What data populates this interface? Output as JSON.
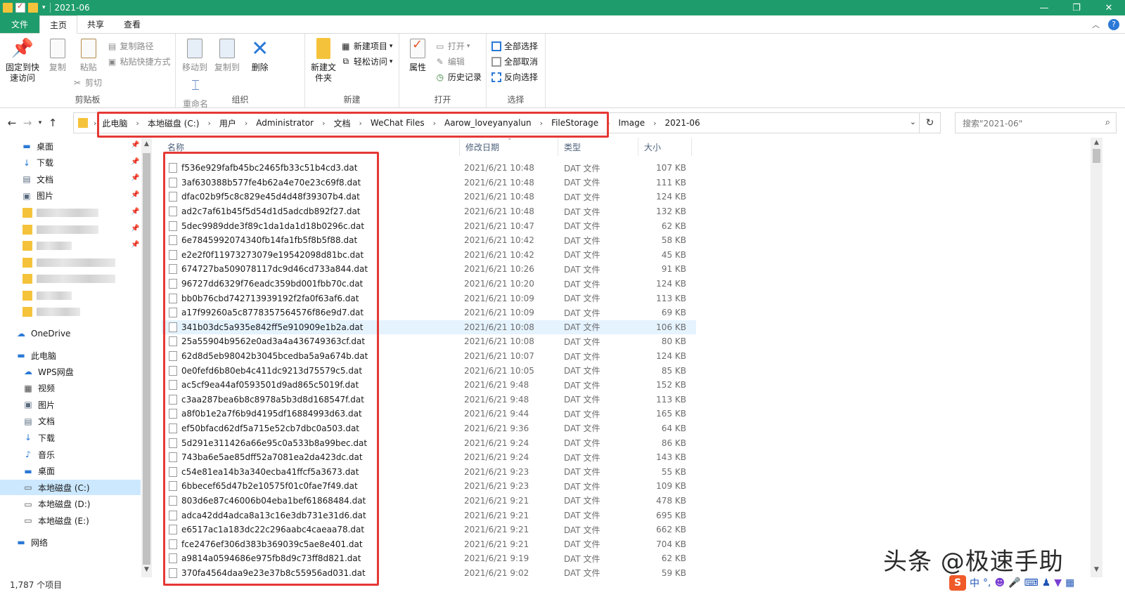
{
  "window": {
    "title": "2021-06",
    "minimize": "—",
    "restore": "❐",
    "close": "✕"
  },
  "tabs": [
    "文件",
    "主页",
    "共享",
    "查看"
  ],
  "ribbon": {
    "clipboard": {
      "group": "剪贴板",
      "pin": "固定到快速访问",
      "copy": "复制",
      "paste": "粘贴",
      "copy_path": "复制路径",
      "paste_shortcut": "粘贴快捷方式",
      "cut": "剪切"
    },
    "organize": {
      "group": "组织",
      "move_to": "移动到",
      "copy_to": "复制到",
      "delete": "删除",
      "rename": "重命名"
    },
    "new": {
      "group": "新建",
      "new_folder": "新建文件夹",
      "new_item": "新建项目",
      "easy_access": "轻松访问"
    },
    "open": {
      "group": "打开",
      "properties": "属性",
      "open": "打开",
      "edit": "编辑",
      "history": "历史记录"
    },
    "select": {
      "group": "选择",
      "select_all": "全部选择",
      "select_none": "全部取消",
      "invert": "反向选择"
    }
  },
  "address": {
    "crumbs": [
      "此电脑",
      "本地磁盘 (C:)",
      "用户",
      "Administrator",
      "文档",
      "WeChat Files",
      "Aarow_loveyanyalun",
      "FileStorage",
      "Image",
      "2021-06"
    ],
    "search_placeholder": "搜索\"2021-06\""
  },
  "nav": {
    "quick": [
      {
        "label": "桌面",
        "icon": "desktop-icon"
      },
      {
        "label": "下载",
        "icon": "download-icon"
      },
      {
        "label": "文档",
        "icon": "document-icon"
      },
      {
        "label": "图片",
        "icon": "picture-icon"
      }
    ],
    "onedrive": "OneDrive",
    "thispc": "此电脑",
    "pc_items": [
      {
        "label": "WPS网盘",
        "icon": "cloud-icon"
      },
      {
        "label": "视频",
        "icon": "video-icon"
      },
      {
        "label": "图片",
        "icon": "picture-icon"
      },
      {
        "label": "文档",
        "icon": "document-icon"
      },
      {
        "label": "下载",
        "icon": "download-icon"
      },
      {
        "label": "音乐",
        "icon": "music-icon"
      },
      {
        "label": "桌面",
        "icon": "desktop-icon"
      },
      {
        "label": "本地磁盘 (C:)",
        "icon": "drive-icon",
        "selected": true
      },
      {
        "label": "本地磁盘 (D:)",
        "icon": "drive-icon"
      },
      {
        "label": "本地磁盘 (E:)",
        "icon": "drive-icon"
      }
    ],
    "network": "网络"
  },
  "columns": {
    "name": "名称",
    "date": "修改日期",
    "type": "类型",
    "size": "大小"
  },
  "files": [
    {
      "name": "f536e929fafb45bc2465fb33c51b4cd3.dat",
      "date": "2021/6/21 10:48",
      "type": "DAT 文件",
      "size": "107 KB"
    },
    {
      "name": "3af630388b577fe4b62a4e70e23c69f8.dat",
      "date": "2021/6/21 10:48",
      "type": "DAT 文件",
      "size": "111 KB"
    },
    {
      "name": "dfac02b9f5c8c829e45d4d48f39307b4.dat",
      "date": "2021/6/21 10:48",
      "type": "DAT 文件",
      "size": "124 KB"
    },
    {
      "name": "ad2c7af61b45f5d54d1d5adcdb892f27.dat",
      "date": "2021/6/21 10:48",
      "type": "DAT 文件",
      "size": "132 KB"
    },
    {
      "name": "5dec9989dde3f89c1da1da1d18b0296c.dat",
      "date": "2021/6/21 10:47",
      "type": "DAT 文件",
      "size": "62 KB"
    },
    {
      "name": "6e7845992074340fb14fa1fb5f8b5f88.dat",
      "date": "2021/6/21 10:42",
      "type": "DAT 文件",
      "size": "58 KB"
    },
    {
      "name": "e2e2f0f11973273079e19542098d81bc.dat",
      "date": "2021/6/21 10:42",
      "type": "DAT 文件",
      "size": "45 KB"
    },
    {
      "name": "674727ba509078117dc9d46cd733a844.dat",
      "date": "2021/6/21 10:26",
      "type": "DAT 文件",
      "size": "91 KB"
    },
    {
      "name": "96727dd6329f76eadc359bd001fbb70c.dat",
      "date": "2021/6/21 10:20",
      "type": "DAT 文件",
      "size": "124 KB"
    },
    {
      "name": "bb0b76cbd742713939192f2fa0f63af6.dat",
      "date": "2021/6/21 10:09",
      "type": "DAT 文件",
      "size": "113 KB"
    },
    {
      "name": "a17f99260a5c8778357564576f86e9d7.dat",
      "date": "2021/6/21 10:09",
      "type": "DAT 文件",
      "size": "69 KB"
    },
    {
      "name": "341b03dc5a935e842ff5e910909e1b2a.dat",
      "date": "2021/6/21 10:08",
      "type": "DAT 文件",
      "size": "106 KB",
      "hover": true
    },
    {
      "name": "25a55904b9562e0ad3a4a436749363cf.dat",
      "date": "2021/6/21 10:08",
      "type": "DAT 文件",
      "size": "80 KB"
    },
    {
      "name": "62d8d5eb98042b3045bcedba5a9a674b.dat",
      "date": "2021/6/21 10:07",
      "type": "DAT 文件",
      "size": "124 KB"
    },
    {
      "name": "0e0fefd6b80eb4c411dc9213d75579c5.dat",
      "date": "2021/6/21 10:05",
      "type": "DAT 文件",
      "size": "85 KB"
    },
    {
      "name": "ac5cf9ea44af0593501d9ad865c5019f.dat",
      "date": "2021/6/21 9:48",
      "type": "DAT 文件",
      "size": "152 KB"
    },
    {
      "name": "c3aa287bea6b8c8978a5b3d8d168547f.dat",
      "date": "2021/6/21 9:48",
      "type": "DAT 文件",
      "size": "113 KB"
    },
    {
      "name": "a8f0b1e2a7f6b9d4195df16884993d63.dat",
      "date": "2021/6/21 9:44",
      "type": "DAT 文件",
      "size": "165 KB"
    },
    {
      "name": "ef50bfacd62df5a715e52cb7dbc0a503.dat",
      "date": "2021/6/21 9:36",
      "type": "DAT 文件",
      "size": "64 KB"
    },
    {
      "name": "5d291e311426a66e95c0a533b8a99bec.dat",
      "date": "2021/6/21 9:24",
      "type": "DAT 文件",
      "size": "86 KB"
    },
    {
      "name": "743ba6e5ae85dff52a7081ea2da423dc.dat",
      "date": "2021/6/21 9:24",
      "type": "DAT 文件",
      "size": "143 KB"
    },
    {
      "name": "c54e81ea14b3a340ecba41ffcf5a3673.dat",
      "date": "2021/6/21 9:23",
      "type": "DAT 文件",
      "size": "55 KB"
    },
    {
      "name": "6bbecef65d47b2e10575f01c0fae7f49.dat",
      "date": "2021/6/21 9:23",
      "type": "DAT 文件",
      "size": "109 KB"
    },
    {
      "name": "803d6e87c46006b04eba1bef61868484.dat",
      "date": "2021/6/21 9:21",
      "type": "DAT 文件",
      "size": "478 KB"
    },
    {
      "name": "adca42dd4adca8a13c16e3db731e31d6.dat",
      "date": "2021/6/21 9:21",
      "type": "DAT 文件",
      "size": "695 KB"
    },
    {
      "name": "e6517ac1a183dc22c296aabc4caeaa78.dat",
      "date": "2021/6/21 9:21",
      "type": "DAT 文件",
      "size": "662 KB"
    },
    {
      "name": "fce2476ef306d383b369039c5ae8e401.dat",
      "date": "2021/6/21 9:21",
      "type": "DAT 文件",
      "size": "704 KB"
    },
    {
      "name": "a9814a0594686e975fb8d9c73ff8d821.dat",
      "date": "2021/6/21 9:19",
      "type": "DAT 文件",
      "size": "62 KB"
    },
    {
      "name": "370fa4564daa9e23e37b8c55956ad031.dat",
      "date": "2021/6/21 9:02",
      "type": "DAT 文件",
      "size": "59 KB"
    }
  ],
  "status": "1,787 个项目",
  "watermark": "头条 @极速手助",
  "ime": {
    "logo": "S",
    "lang": "中",
    "punct": "°,"
  },
  "colors": {
    "title_bar": "#1f9c6b",
    "highlight": "#e53935",
    "selection": "#cce8ff"
  }
}
